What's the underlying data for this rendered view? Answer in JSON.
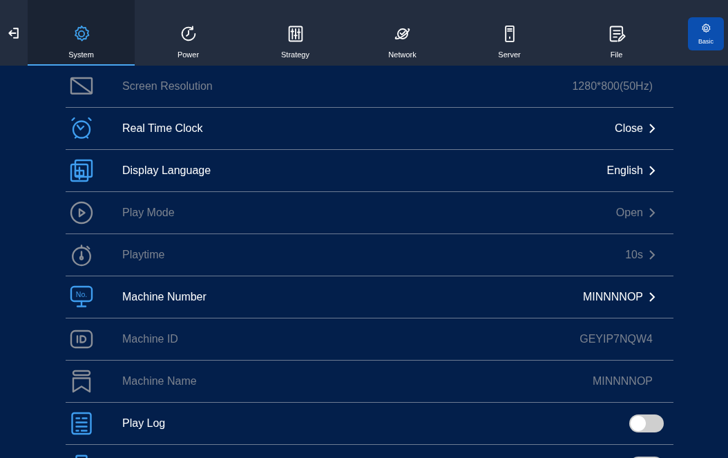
{
  "tabs": [
    {
      "label": "System",
      "selected": true
    },
    {
      "label": "Power",
      "selected": false
    },
    {
      "label": "Strategy",
      "selected": false
    },
    {
      "label": "Network",
      "selected": false
    },
    {
      "label": "Server",
      "selected": false
    },
    {
      "label": "File",
      "selected": false
    }
  ],
  "side_button": {
    "label": "Basic",
    "selected": true
  },
  "settings": [
    {
      "kind": "info",
      "label": "Screen Resolution",
      "value": "1280*800(50Hz)",
      "disabled": true
    },
    {
      "kind": "link",
      "label": "Real Time Clock",
      "value": "Close",
      "disabled": false
    },
    {
      "kind": "link",
      "label": "Display Language",
      "value": "English",
      "disabled": false
    },
    {
      "kind": "link",
      "label": "Play Mode",
      "value": "Open",
      "disabled": true
    },
    {
      "kind": "link",
      "label": "Playtime",
      "value": "10s",
      "disabled": true
    },
    {
      "kind": "link",
      "icon_text": "No.",
      "label": "Machine Number",
      "value": "MINNNNOP",
      "disabled": false
    },
    {
      "kind": "info",
      "label": "Machine ID",
      "value": "GEYIP7NQW4",
      "disabled": true
    },
    {
      "kind": "info",
      "label": "Machine Name",
      "value": "MINNNNOP",
      "disabled": true
    },
    {
      "kind": "toggle",
      "label": "Play Log",
      "on": false,
      "disabled": false
    },
    {
      "kind": "toggle",
      "on": false,
      "disabled": false
    }
  ]
}
